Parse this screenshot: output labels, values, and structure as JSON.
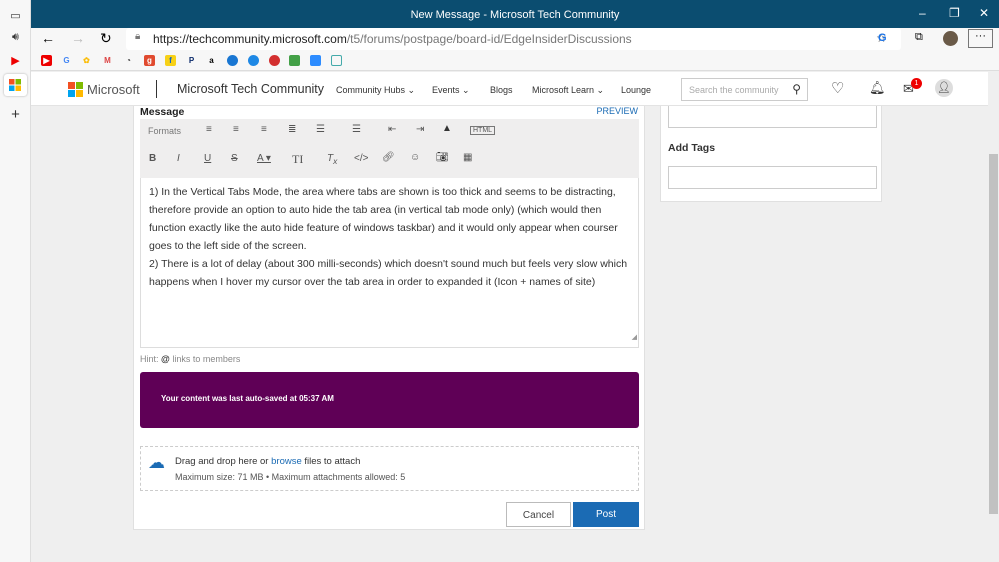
{
  "browser": {
    "title": "New Message - Microsoft Tech Community",
    "url_host": "https://techcommunity.microsoft.com",
    "url_path": "/t5/forums/postpage/board-id/EdgeInsiderDiscussions",
    "menu": "···"
  },
  "site": {
    "logo": "Microsoft",
    "name": "Microsoft Tech Community",
    "nav": [
      "Community Hubs",
      "Events",
      "Blogs",
      "Microsoft Learn",
      "Lounge"
    ],
    "search_placeholder": "Search the community",
    "inbox_badge": "1"
  },
  "editor": {
    "label": "Message",
    "preview": "PREVIEW",
    "formats": "Formats",
    "html": "HTML",
    "paragraphs": [
      "1) In the Vertical Tabs Mode, the area where tabs are shown is too thick and seems to be distracting, therefore provide an option to auto hide the tab area (in vertical tab mode only) (which would then function exactly like the auto hide feature of windows taskbar) and it would only appear when courser goes to the left side of the screen.",
      "2) There is a lot of delay (about 300 milli-seconds) which doesn't sound much but feels very slow which happens when I hover my cursor over the tab area in order to expanded it (Icon + names of site)"
    ]
  },
  "hint": {
    "label": "Hint:",
    "text": "links to members"
  },
  "autosave": "Your content was last auto-saved at 05:37 AM",
  "attach": {
    "pre": "Drag and drop here or ",
    "link": "browse",
    "post": " files to attach",
    "limits": "Maximum size: 71 MB • Maximum attachments allowed: 5"
  },
  "buttons": {
    "cancel": "Cancel",
    "post": "Post"
  },
  "right": {
    "add_tags": "Add Tags"
  },
  "colors": {
    "titlebar": "#0b4d70",
    "banner": "#5f0056",
    "primary": "#1b6bb4"
  }
}
